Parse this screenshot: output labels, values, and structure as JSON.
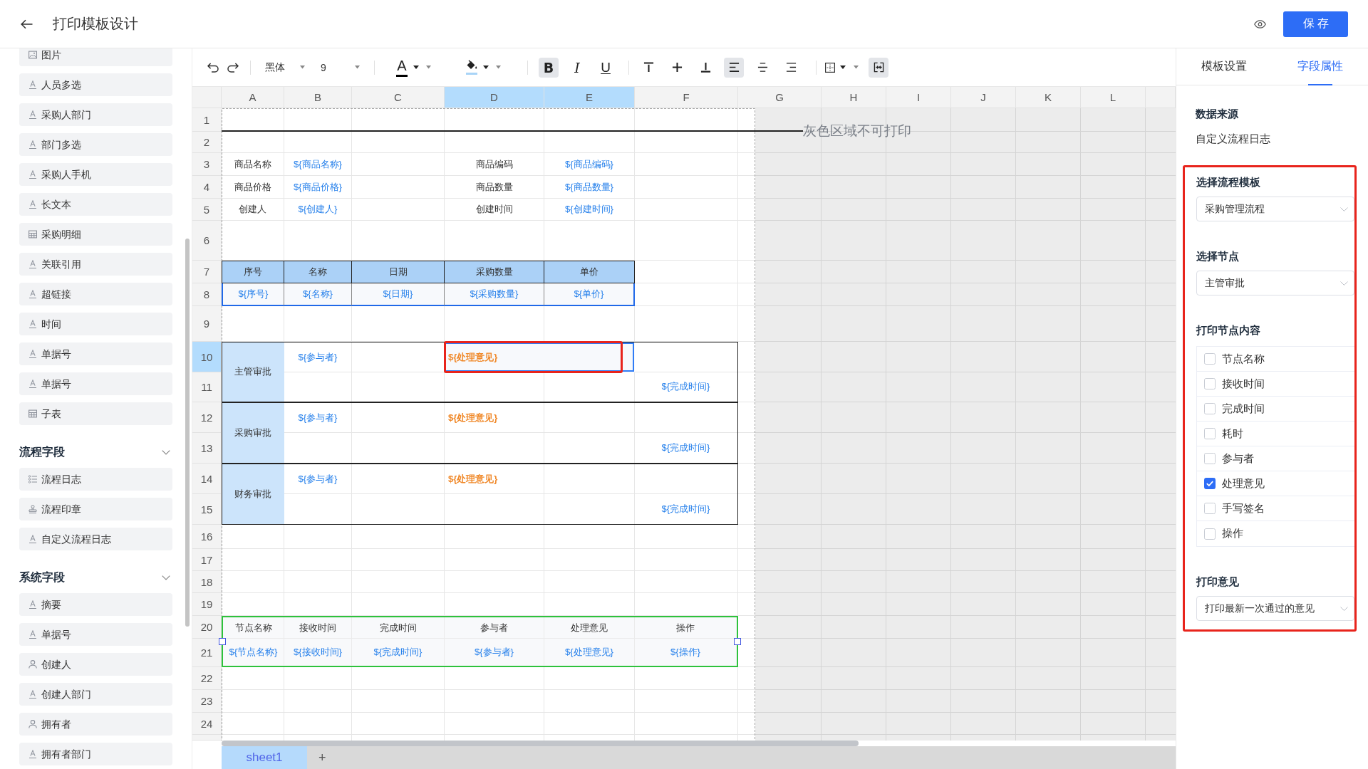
{
  "header": {
    "title": "打印模板设计",
    "save": "保存"
  },
  "sidebar": {
    "sections": [
      {
        "items": [
          {
            "label": "图片",
            "kind": "image"
          },
          {
            "label": "人员多选",
            "kind": "text"
          },
          {
            "label": "采购人部门",
            "kind": "text"
          },
          {
            "label": "部门多选",
            "kind": "text"
          },
          {
            "label": "采购人手机",
            "kind": "text"
          },
          {
            "label": "长文本",
            "kind": "text"
          },
          {
            "label": "采购明细",
            "kind": "table"
          },
          {
            "label": "关联引用",
            "kind": "text"
          },
          {
            "label": "超链接",
            "kind": "text"
          },
          {
            "label": "时间",
            "kind": "text"
          },
          {
            "label": "单据号",
            "kind": "text"
          },
          {
            "label": "单据号",
            "kind": "text"
          },
          {
            "label": "子表",
            "kind": "table"
          }
        ]
      },
      {
        "title": "流程字段",
        "expanded": true,
        "items": [
          {
            "label": "流程日志",
            "kind": "list"
          },
          {
            "label": "流程印章",
            "kind": "stamp"
          },
          {
            "label": "自定义流程日志",
            "kind": "text"
          }
        ]
      },
      {
        "title": "系统字段",
        "expanded": true,
        "items": [
          {
            "label": "摘要",
            "kind": "text"
          },
          {
            "label": "单据号",
            "kind": "text"
          },
          {
            "label": "创建人",
            "kind": "user"
          },
          {
            "label": "创建人部门",
            "kind": "text"
          },
          {
            "label": "拥有者",
            "kind": "user"
          },
          {
            "label": "拥有者部门",
            "kind": "text"
          }
        ]
      }
    ]
  },
  "toolbar": {
    "font": "黑体",
    "size": "9",
    "font_color": {
      "label": "A",
      "color": "#000000"
    },
    "fill_color": {
      "color": "#a9d4f7"
    },
    "format": [
      {
        "label": "B",
        "kind": "bold",
        "on": true
      },
      {
        "label": "I",
        "kind": "italic",
        "on": false
      },
      {
        "label": "U",
        "kind": "underline",
        "on": false
      }
    ],
    "vertical_align": [
      {
        "kind": "top",
        "selected": false
      },
      {
        "kind": "middle",
        "selected": false
      },
      {
        "kind": "bottom",
        "selected": false
      }
    ],
    "horizontal_align": [
      {
        "kind": "left",
        "selected": true
      },
      {
        "kind": "center",
        "selected": false
      },
      {
        "kind": "right",
        "selected": false
      }
    ],
    "merge_on": true
  },
  "sheet": {
    "columns": [
      {
        "label": "A",
        "selected": false
      },
      {
        "label": "B",
        "selected": false
      },
      {
        "label": "C",
        "selected": false
      },
      {
        "label": "D",
        "selected": true
      },
      {
        "label": "E",
        "selected": true
      },
      {
        "label": "F",
        "selected": false
      },
      {
        "label": "G",
        "selected": false
      },
      {
        "label": "H",
        "selected": false
      },
      {
        "label": "I",
        "selected": false
      },
      {
        "label": "J",
        "selected": false
      },
      {
        "label": "K",
        "selected": false
      },
      {
        "label": "L",
        "selected": false
      }
    ],
    "rows": [
      {
        "label": "1",
        "selected": false
      },
      {
        "label": "2",
        "selected": false
      },
      {
        "label": "3",
        "selected": false
      },
      {
        "label": "4",
        "selected": false
      },
      {
        "label": "5",
        "selected": false
      },
      {
        "label": "6",
        "selected": false
      },
      {
        "label": "7",
        "selected": false
      },
      {
        "label": "8",
        "selected": false
      },
      {
        "label": "9",
        "selected": false
      },
      {
        "label": "10",
        "selected": true
      },
      {
        "label": "11",
        "selected": false
      },
      {
        "label": "12",
        "selected": false
      },
      {
        "label": "13",
        "selected": false
      },
      {
        "label": "14",
        "selected": false
      },
      {
        "label": "15",
        "selected": false
      },
      {
        "label": "16",
        "selected": false
      },
      {
        "label": "17",
        "selected": false
      },
      {
        "label": "18",
        "selected": false
      },
      {
        "label": "19",
        "selected": false
      },
      {
        "label": "20",
        "selected": false
      },
      {
        "label": "21",
        "selected": false
      },
      {
        "label": "22",
        "selected": false
      },
      {
        "label": "23",
        "selected": false
      },
      {
        "label": "24",
        "selected": false
      }
    ],
    "print_note": "灰色区域不可打印",
    "info_fields": [
      {
        "label": "商品名称",
        "value": "${商品名称}"
      },
      {
        "label": "商品编码",
        "value": "${商品编码}"
      },
      {
        "label": "商品价格",
        "value": "${商品价格}"
      },
      {
        "label": "商品数量",
        "value": "${商品数量}"
      },
      {
        "label": "创建人",
        "value": "${创建人}"
      },
      {
        "label": "创建时间",
        "value": "${创建时间}"
      }
    ],
    "detail_table": {
      "columns": [
        {
          "header": "序号",
          "field": "${序号}"
        },
        {
          "header": "名称",
          "field": "${名称}"
        },
        {
          "header": "日期",
          "field": "${日期}"
        },
        {
          "header": "采购数量",
          "field": "${采购数量}"
        },
        {
          "header": "单价",
          "field": "${单价}"
        }
      ]
    },
    "approval_nodes": [
      {
        "label": "主管审批",
        "participant": "${参与者}",
        "opinion": "${处理意见}",
        "completed": "${完成时间}",
        "opinion_selected": true,
        "opinion_highlighted": true
      },
      {
        "label": "采购审批",
        "participant": "${参与者}",
        "opinion": "${处理意见}",
        "completed": "${完成时间}",
        "opinion_selected": false,
        "opinion_highlighted": false
      },
      {
        "label": "财务审批",
        "participant": "${参与者}",
        "opinion": "${处理意见}",
        "completed": "${完成时间}",
        "opinion_selected": false,
        "opinion_highlighted": false
      }
    ],
    "node_log": {
      "selected": true,
      "columns": [
        {
          "header": "节点名称",
          "field": "${节点名称}"
        },
        {
          "header": "接收时间",
          "field": "${接收时间}"
        },
        {
          "header": "完成时间",
          "field": "${完成时间}"
        },
        {
          "header": "参与者",
          "field": "${参与者}"
        },
        {
          "header": "处理意见",
          "field": "${处理意见}"
        },
        {
          "header": "操作",
          "field": "${操作}"
        }
      ]
    },
    "tabs": [
      {
        "label": "sheet1",
        "selected": true
      }
    ],
    "add_tab": "+"
  },
  "properties": {
    "tabs": [
      {
        "label": "模板设置",
        "selected": false
      },
      {
        "label": "字段属性",
        "selected": true
      }
    ],
    "data_source_label": "数据来源",
    "data_source": "自定义流程日志",
    "highlighted": true,
    "fields": [
      {
        "label": "选择流程模板",
        "kind": "select",
        "value": "采购管理流程"
      },
      {
        "label": "选择节点",
        "kind": "select",
        "value": "主管审批"
      },
      {
        "label": "打印节点内容",
        "kind": "checklist",
        "options": [
          {
            "label": "节点名称",
            "checked": false
          },
          {
            "label": "接收时间",
            "checked": false
          },
          {
            "label": "完成时间",
            "checked": false
          },
          {
            "label": "耗时",
            "checked": false
          },
          {
            "label": "参与者",
            "checked": false
          },
          {
            "label": "处理意见",
            "checked": true
          },
          {
            "label": "手写签名",
            "checked": false
          },
          {
            "label": "操作",
            "checked": false
          }
        ]
      },
      {
        "label": "打印意见",
        "kind": "select",
        "value": "打印最新一次通过的意见"
      }
    ]
  }
}
